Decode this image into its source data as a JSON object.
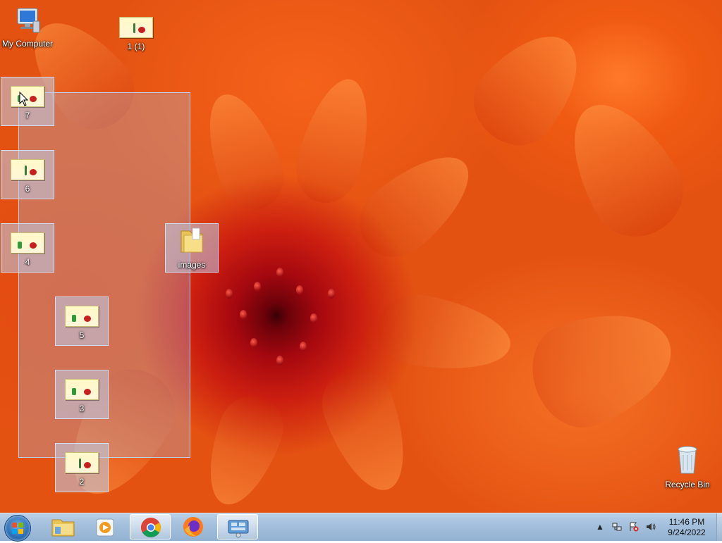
{
  "desktop": {
    "icons": [
      {
        "label": "My Computer",
        "kind": "computer-icon"
      },
      {
        "label": "1 (1)",
        "kind": "image-file-icon"
      },
      {
        "label": "7",
        "kind": "image-file-icon",
        "selected": true
      },
      {
        "label": "6",
        "kind": "image-file-icon",
        "selected": true
      },
      {
        "label": "4",
        "kind": "image-file-icon",
        "selected": true
      },
      {
        "label": "images",
        "kind": "folder-icon",
        "selected": true
      },
      {
        "label": "5",
        "kind": "image-file-icon",
        "selected": true
      },
      {
        "label": "3",
        "kind": "image-file-icon",
        "selected": true
      },
      {
        "label": "2",
        "kind": "image-file-icon",
        "selected": true
      },
      {
        "label": "Recycle Bin",
        "kind": "recycle-bin-icon"
      }
    ]
  },
  "taskbar": {
    "buttons": [
      {
        "name": "windows-explorer",
        "icon": "folder-icon"
      },
      {
        "name": "media-player",
        "icon": "media-player-icon"
      },
      {
        "name": "chrome",
        "icon": "chrome-icon",
        "active": true
      },
      {
        "name": "firefox",
        "icon": "firefox-icon"
      },
      {
        "name": "control-panel",
        "icon": "control-panel-icon",
        "active": true
      }
    ],
    "tray": {
      "icons": [
        "show-hidden-icons",
        "network-icon",
        "action-center-icon",
        "volume-icon"
      ]
    },
    "clock": {
      "time": "11:46 PM",
      "date": "9/24/2022"
    }
  },
  "colors": {
    "taskbar": "#a3bfdc",
    "selection": "#aac3f0"
  }
}
